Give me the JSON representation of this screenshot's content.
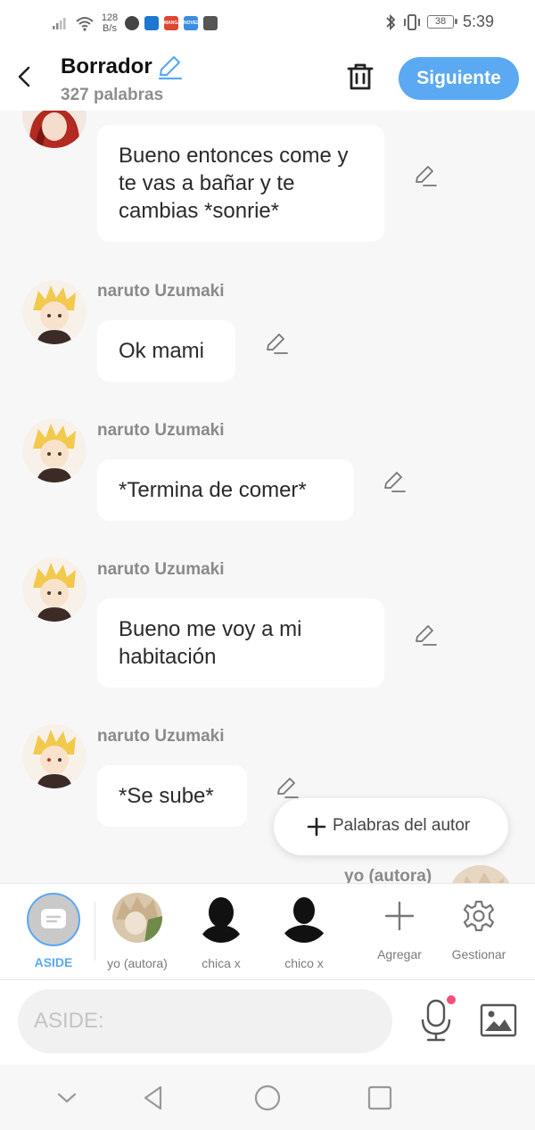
{
  "status_bar": {
    "net_speed_value": "128",
    "net_speed_unit": "B/s",
    "apps": [
      {
        "name": "chrome-icon",
        "color": "#444444"
      },
      {
        "name": "shield-app-icon",
        "color": "#1e78d2"
      },
      {
        "name": "manga-toon-icon",
        "color": "#e0452e",
        "label": "MANGA TOON"
      },
      {
        "name": "novel-toon-icon",
        "color": "#3a8de0",
        "label": "NOVEL TOON"
      },
      {
        "name": "facebook-icon",
        "color": "#555555"
      }
    ],
    "battery": "38",
    "time": "5:39"
  },
  "header": {
    "title": "Borrador",
    "word_count": "327 palabras",
    "next_label": "Siguiente"
  },
  "messages": [
    {
      "name": "",
      "text": "Bueno entonces come y te vas a bañar y te cambias *sonrie*",
      "avatar": "red-hair-avatar"
    },
    {
      "name": "naruto Uzumaki",
      "text": "Ok mami",
      "avatar": "naruto-avatar"
    },
    {
      "name": "naruto Uzumaki",
      "text": "*Termina de comer*",
      "avatar": "naruto-avatar"
    },
    {
      "name": "naruto Uzumaki",
      "text": "Bueno me voy a mi habitación",
      "avatar": "naruto-avatar"
    },
    {
      "name": "naruto Uzumaki",
      "text": "*Se sube*",
      "avatar": "naruto-avatar"
    }
  ],
  "partial_message_name": "yo (autora)",
  "fab_label": "Palabras del autor",
  "characters": [
    {
      "label": "ASIDE",
      "active": true
    },
    {
      "label": "yo (autora)"
    },
    {
      "label": "chica x"
    },
    {
      "label": "chico x"
    }
  ],
  "tools": {
    "add_label": "Agregar",
    "manage_label": "Gestionar"
  },
  "input": {
    "placeholder": "ASIDE:"
  },
  "colors": {
    "accent": "#5aa9f2",
    "notification_dot": "#f0507a"
  }
}
